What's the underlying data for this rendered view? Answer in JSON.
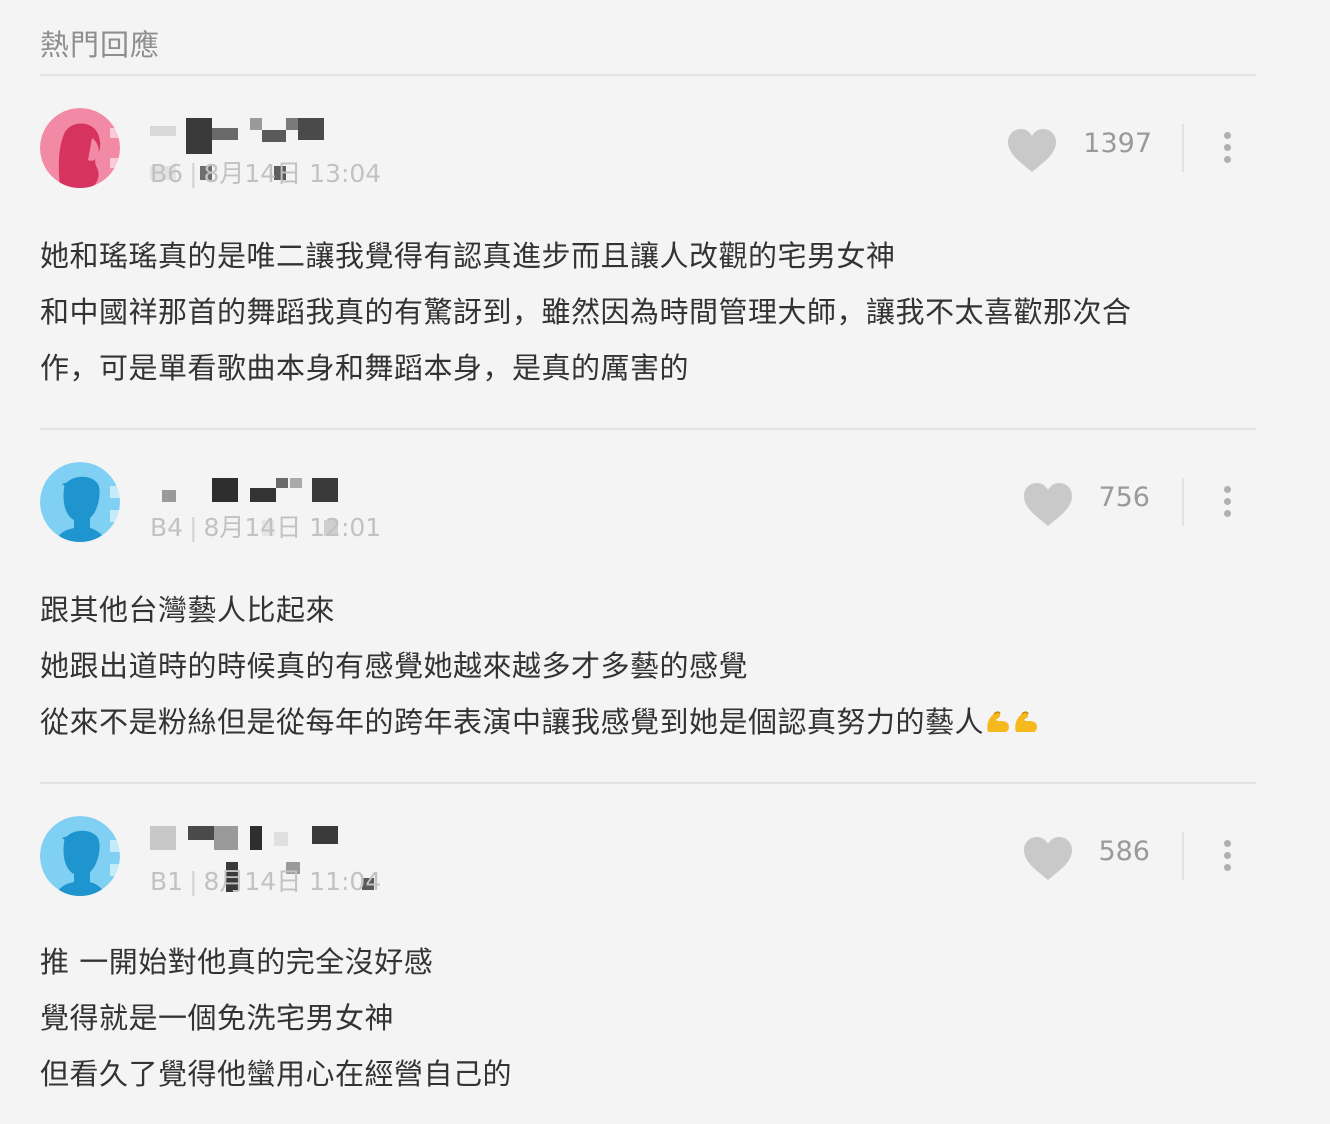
{
  "section_title": "熱門回應",
  "comments": [
    {
      "author": "",
      "floor": "B6",
      "date": "8月14日",
      "time": "13:04",
      "likes": "1397",
      "avatar": "female-avatar",
      "avatar_color": "#e5437a",
      "lines": [
        "她和瑤瑤真的是唯二讓我覺得有認真進步而且讓人改觀的宅男女神",
        "和中國祥那首的舞蹈我真的有驚訝到，雖然因為時間管理大師，讓我不太喜歡那次合",
        "作，可是單看歌曲本身和舞蹈本身，是真的厲害的"
      ]
    },
    {
      "author": "",
      "floor": "B4",
      "date": "8月14日",
      "time": "12:01",
      "likes": "756",
      "avatar": "male-avatar",
      "avatar_color": "#3fb1e6",
      "lines": [
        "跟其他台灣藝人比起來",
        "她跟出道時的時候真的有感覺她越來越多才多藝的感覺",
        "從來不是粉絲但是從每年的跨年表演中讓我感覺到她是個認真努力的藝人"
      ],
      "trailing_emoji": "💪💪"
    },
    {
      "author": "",
      "floor": "B1",
      "date": "8月14日",
      "time": "11:04",
      "likes": "586",
      "avatar": "male-avatar",
      "avatar_color": "#3fb1e6",
      "lines": [
        "推 一開始對他真的完全沒好感",
        "覺得就是一個免洗宅男女神",
        "但看久了覺得他蠻用心在經營自己的"
      ]
    }
  ],
  "colors": {
    "background": "#f4f4f4",
    "text": "#333333",
    "muted": "#c2c2c2",
    "heart": "#c9c9c9"
  }
}
